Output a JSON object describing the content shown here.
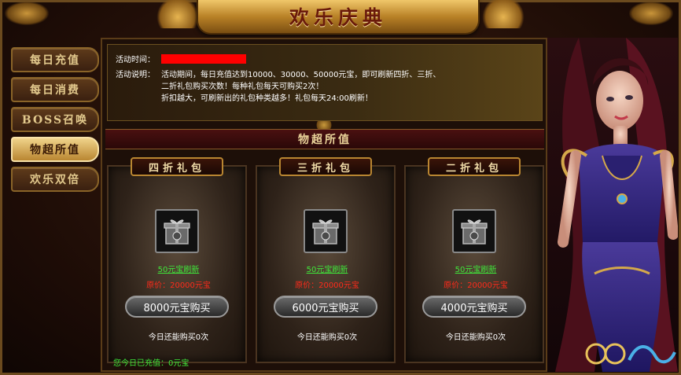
{
  "header": {
    "title": "欢乐庆典"
  },
  "sidebar": {
    "items": [
      {
        "label": "每日充值"
      },
      {
        "label": "每日消费"
      },
      {
        "label": "BOSS召唤"
      },
      {
        "label": "物超所值"
      },
      {
        "label": "欢乐双倍"
      }
    ],
    "active_index": 3
  },
  "info": {
    "time_label": "活动时间：",
    "desc_label": "活动说明：",
    "desc_lines": [
      "活动期间，每日充值达到10000、30000、50000元宝，即可刷新四折、三折、",
      "二折礼包购买次数！每种礼包每天可购买2次！",
      "折扣越大，可刷新出的礼包种类越多！礼包每天24:00刷新！"
    ]
  },
  "section": {
    "title": "物超所值"
  },
  "cards": [
    {
      "title": "四折礼包",
      "refresh": "50元宝刷新",
      "orig_price": "原价：20000元宝",
      "buy": "8000元宝购买",
      "remain": "今日还能购买0次"
    },
    {
      "title": "三折礼包",
      "refresh": "50元宝刷新",
      "orig_price": "原价：20000元宝",
      "buy": "6000元宝购买",
      "remain": "今日还能购买0次"
    },
    {
      "title": "二折礼包",
      "refresh": "50元宝刷新",
      "orig_price": "原价：20000元宝",
      "buy": "4000元宝购买",
      "remain": "今日还能购买0次"
    }
  ],
  "footer": {
    "today_paid": "您今日已充值：0元宝"
  },
  "colors": {
    "gold": "#b98631",
    "green_link": "#3fe83a",
    "red_price": "#ff2a1a",
    "redaction": "#ff0000"
  },
  "icons": {
    "gift": "gift-box-icon"
  }
}
